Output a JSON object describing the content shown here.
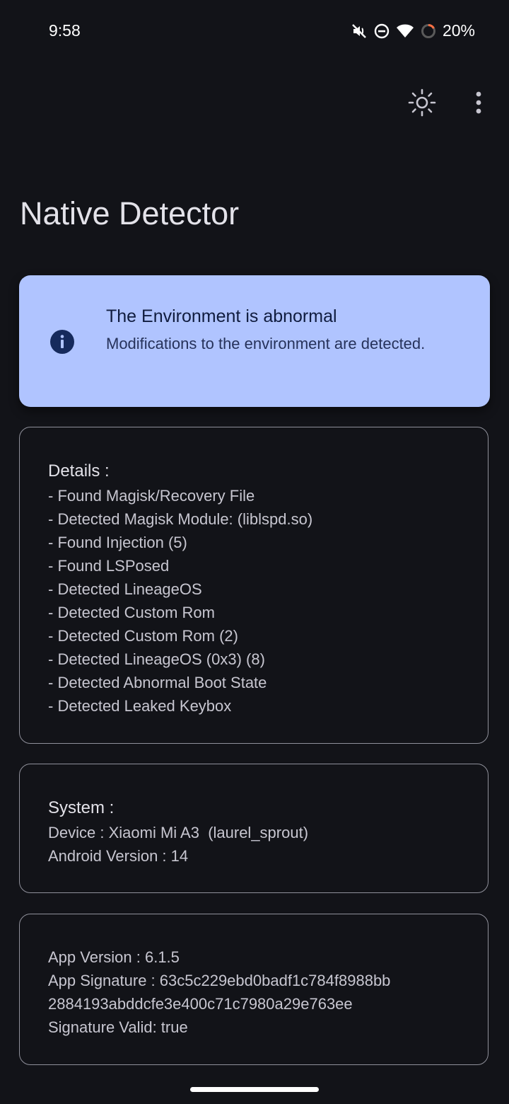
{
  "status_bar": {
    "time": "9:58",
    "battery": "20%",
    "icons": [
      "mute-icon",
      "dnd-icon",
      "wifi-icon",
      "battery-ring-icon"
    ]
  },
  "toolbar": {
    "icons": [
      "brightness-icon",
      "more-vert-icon"
    ]
  },
  "app": {
    "title": "Native Detector"
  },
  "alert": {
    "icon": "info-icon",
    "title": "The Environment is abnormal",
    "description": "Modifications to the environment are detected."
  },
  "details": {
    "heading": "Details :",
    "items": [
      "- Found Magisk/Recovery File",
      "- Detected Magisk Module: (liblspd.so)",
      "- Found Injection (5)",
      "- Found LSPosed",
      "- Detected LineageOS",
      "- Detected Custom Rom",
      "- Detected Custom Rom (2)",
      "- Detected LineageOS (0x3) (8)",
      "- Detected Abnormal Boot State",
      "- Detected Leaked Keybox"
    ]
  },
  "system": {
    "heading": "System :",
    "lines": [
      "Device : Xiaomi Mi A3  (laurel_sprout)",
      "Android Version : 14"
    ]
  },
  "app_info": {
    "lines": [
      "App Version : 6.1.5",
      "App Signature : 63c5c229ebd0badf1c784f8988bb",
      "2884193abddcfe3e400c71c7980a29e763ee",
      "Signature Valid: true"
    ]
  },
  "colors": {
    "background": "#121318",
    "alert_bg": "#b0c4ff",
    "card_border": "#8f909a"
  }
}
